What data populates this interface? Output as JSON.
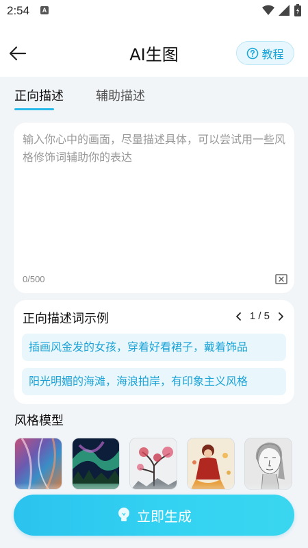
{
  "status_bar": {
    "time": "2:54",
    "notification_badge": "A"
  },
  "header": {
    "title": "AI生图",
    "tutorial_label": "教程"
  },
  "tabs": [
    {
      "label": "正向描述",
      "active": true
    },
    {
      "label": "辅助描述",
      "active": false
    }
  ],
  "prompt": {
    "placeholder": "输入你心中的画面，尽量描述具体，可以尝试用一些风格修饰词辅助你的表达",
    "value": "",
    "char_count": "0/500"
  },
  "examples": {
    "title": "正向描述词示例",
    "page": "1 / 5",
    "items": [
      "插画风金发的女孩，穿着好看裙子，戴着饰品",
      "阳光明媚的海滩，海浪拍岸，有印象主义风格"
    ]
  },
  "styles": {
    "title": "风格模型",
    "items": [
      {
        "icon": "abstract-colorful-thumbnail"
      },
      {
        "icon": "aurora-landscape-thumbnail"
      },
      {
        "icon": "ink-plum-blossom-thumbnail"
      },
      {
        "icon": "fantasy-illustration-thumbnail"
      },
      {
        "icon": "pencil-sketch-portrait-thumbnail"
      }
    ]
  },
  "generate": {
    "label": "立即生成"
  },
  "colors": {
    "accent": "#27b9ea",
    "example_text": "#1ea3d6",
    "example_bg": "#e9f7fd"
  }
}
